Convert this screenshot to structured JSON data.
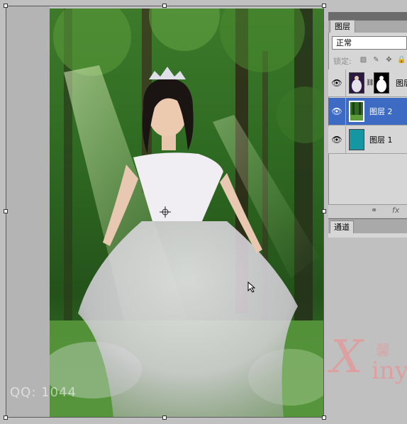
{
  "layers_panel": {
    "tab_label": "图层",
    "blend_mode": "正常",
    "lock_label": "锁定:",
    "layers": [
      {
        "name": "图层",
        "visible": true,
        "selected": false,
        "has_mask": true
      },
      {
        "name": "图层 2",
        "visible": true,
        "selected": true,
        "has_mask": false
      },
      {
        "name": "图层 1",
        "visible": true,
        "selected": false,
        "has_mask": false
      }
    ],
    "footer_icons": [
      "link-icon",
      "fx-icon"
    ],
    "footer_fx": "fx"
  },
  "channels_panel": {
    "tab_label": "通道"
  },
  "watermark": {
    "qq_text": "QQ:    1044"
  },
  "brand": {
    "x": "X",
    "rest": "iny",
    "cn": "馨"
  },
  "colors": {
    "selection": "#3d6bc4",
    "layer1_fill": "#1596a3",
    "panel_bg": "#d6d6d6"
  }
}
